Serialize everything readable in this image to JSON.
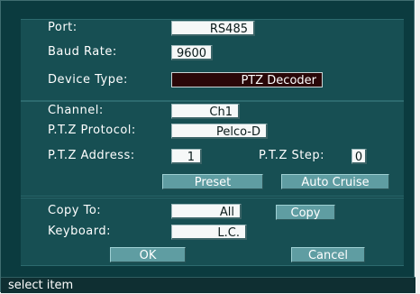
{
  "fields": {
    "port": {
      "label": "Port:",
      "value": "RS485"
    },
    "baud_rate": {
      "label": "Baud Rate:",
      "value": "9600"
    },
    "device_type": {
      "label": "Device Type:",
      "value": "PTZ Decoder"
    },
    "channel": {
      "label": "Channel:",
      "value": "Ch1"
    },
    "ptz_protocol": {
      "label": "P.T.Z Protocol:",
      "value": "Pelco-D"
    },
    "ptz_address": {
      "label": "P.T.Z Address:",
      "value": "1"
    },
    "ptz_step": {
      "label": "P.T.Z Step:",
      "value": "0"
    },
    "copy_to": {
      "label": "Copy To:",
      "value": "All"
    },
    "keyboard": {
      "label": "Keyboard:",
      "value": "L.C."
    }
  },
  "buttons": {
    "preset": "Preset",
    "auto_cruise": "Auto Cruise",
    "copy": "Copy",
    "ok": "OK",
    "cancel": "Cancel"
  },
  "status": {
    "text": "select item"
  }
}
